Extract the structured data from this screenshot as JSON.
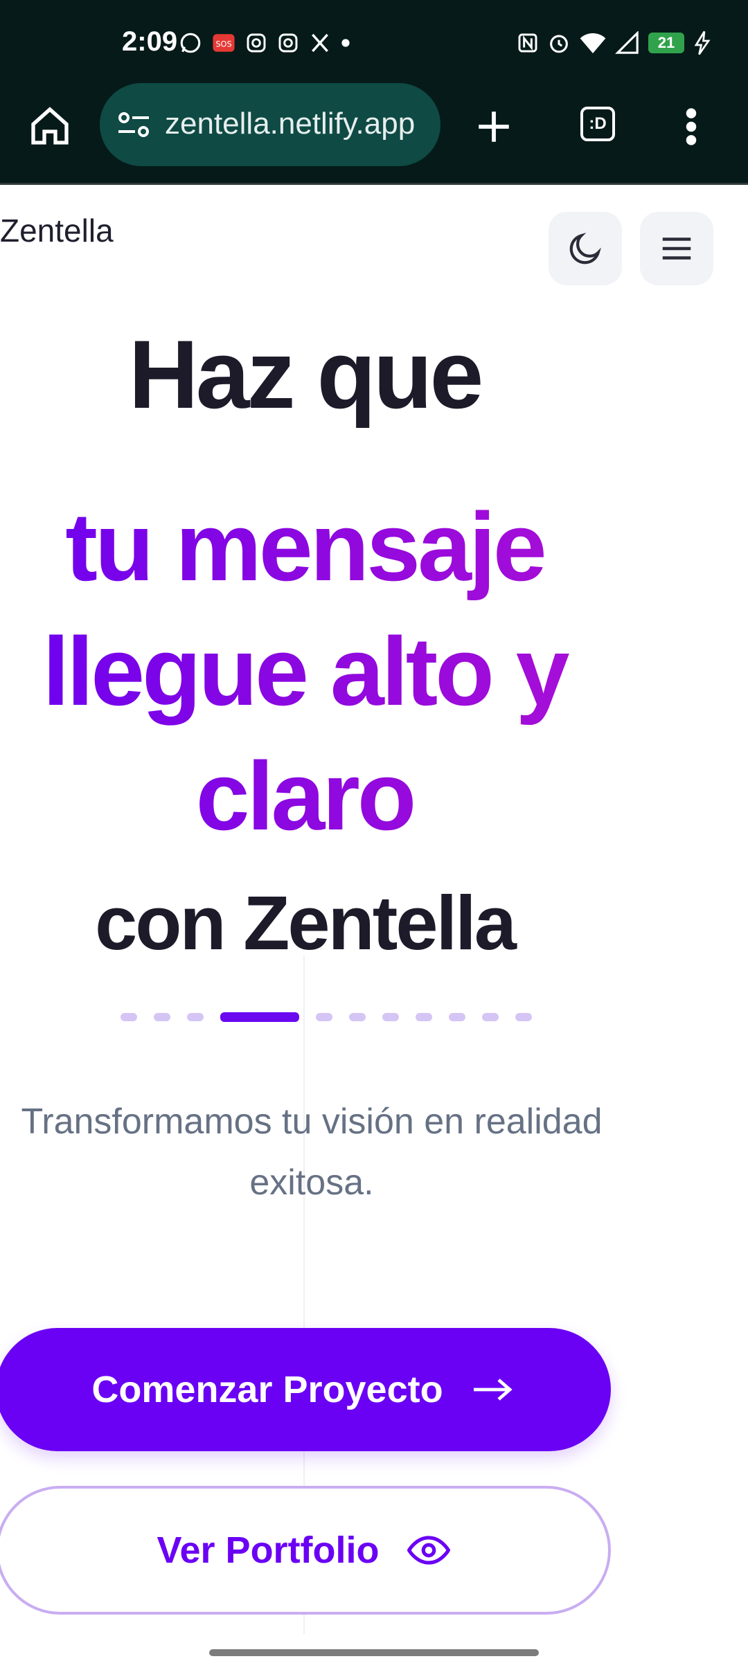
{
  "status_bar": {
    "time": "2:09",
    "battery": "21",
    "icons_left": [
      "whatsapp-icon",
      "sos-icon",
      "instagram-icon",
      "instagram-icon",
      "x-icon",
      "dot-icon"
    ],
    "icons_right": [
      "nfc-icon",
      "alarm-icon",
      "wifi-icon",
      "signal-icon",
      "battery-icon",
      "charging-icon"
    ]
  },
  "browser": {
    "url": "zentella.netlify.app",
    "tab_count_label": ":D"
  },
  "site": {
    "name": "Zentella"
  },
  "hero": {
    "line1": "Haz que",
    "line2": "tu mensaje",
    "line3": "llegue alto y",
    "line4": "claro",
    "line5": "con Zentella",
    "carousel_active_index": 3,
    "carousel_total": 11,
    "tagline": "Transformamos tu visión en realidad exitosa."
  },
  "actions": {
    "primary_label": "Comenzar Proyecto",
    "secondary_label": "Ver Portfolio"
  },
  "colors": {
    "accent": "#6a00f4",
    "gradient_end": "#a90fd6",
    "chrome_bg": "#051a19"
  }
}
